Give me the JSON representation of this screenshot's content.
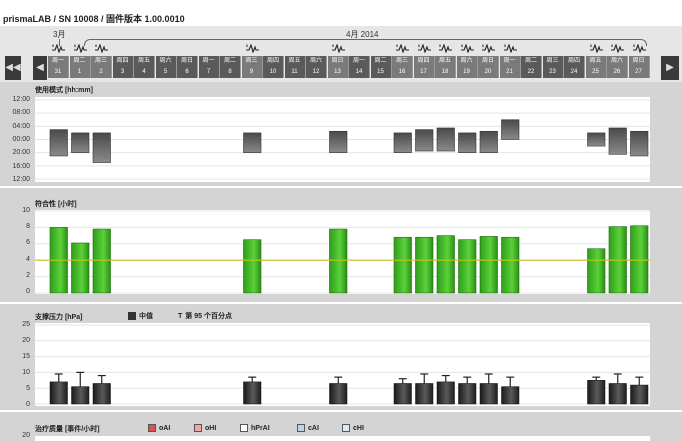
{
  "header": {
    "title": "prismaLAB / SN 10008 / 固件版本 1.00.0010"
  },
  "timeline": {
    "months": [
      {
        "label": "3月"
      },
      {
        "label": "4月 2014"
      }
    ],
    "prev_label": "◀◀",
    "next_label": "▶",
    "days": [
      {
        "wd": "周一",
        "d": "31",
        "data": true
      },
      {
        "wd": "周二",
        "d": "1",
        "data": true
      },
      {
        "wd": "周三",
        "d": "2",
        "data": true
      },
      {
        "wd": "周四",
        "d": "3",
        "data": false
      },
      {
        "wd": "周五",
        "d": "4",
        "data": false
      },
      {
        "wd": "周六",
        "d": "5",
        "data": false
      },
      {
        "wd": "周日",
        "d": "6",
        "data": false
      },
      {
        "wd": "周一",
        "d": "7",
        "data": false
      },
      {
        "wd": "周二",
        "d": "8",
        "data": false
      },
      {
        "wd": "周三",
        "d": "9",
        "data": true
      },
      {
        "wd": "周四",
        "d": "10",
        "data": false
      },
      {
        "wd": "周五",
        "d": "11",
        "data": false
      },
      {
        "wd": "周六",
        "d": "12",
        "data": false
      },
      {
        "wd": "周日",
        "d": "13",
        "data": true
      },
      {
        "wd": "周一",
        "d": "14",
        "data": false
      },
      {
        "wd": "周二",
        "d": "15",
        "data": false
      },
      {
        "wd": "周三",
        "d": "16",
        "data": true
      },
      {
        "wd": "周四",
        "d": "17",
        "data": true
      },
      {
        "wd": "周五",
        "d": "18",
        "data": true
      },
      {
        "wd": "周六",
        "d": "19",
        "data": true
      },
      {
        "wd": "周日",
        "d": "20",
        "data": true
      },
      {
        "wd": "周一",
        "d": "21",
        "data": true
      },
      {
        "wd": "周二",
        "d": "22",
        "data": false
      },
      {
        "wd": "周三",
        "d": "23",
        "data": false
      },
      {
        "wd": "周四",
        "d": "24",
        "data": false
      },
      {
        "wd": "周五",
        "d": "25",
        "data": true
      },
      {
        "wd": "周六",
        "d": "26",
        "data": true
      },
      {
        "wd": "周日",
        "d": "27",
        "data": true
      }
    ],
    "colors": {
      "day_bg": "#5a5a5a",
      "day_bg_data": "#7a7a7a",
      "nav_bg": "#3a3a3a"
    }
  },
  "panels": {
    "usage": {
      "title": "使用模式 [hh:mm]",
      "yticks": [
        "12:00",
        "08:00",
        "04:00",
        "00:00",
        "20:00",
        "16:00",
        "12:00"
      ]
    },
    "compliance": {
      "title": "符合性 [小时]",
      "yticks": [
        "10",
        "8",
        "6",
        "4",
        "2",
        "0"
      ]
    },
    "pressure": {
      "title": "支撑压力 [hPa]",
      "legend_median": "中值",
      "legend_p95_symbol": "T",
      "legend_p95": "第 95 个百分点",
      "yticks": [
        "25",
        "20",
        "15",
        "10",
        "5",
        "0"
      ]
    },
    "events": {
      "title": "治疗质量 [事件/小时]",
      "legend": [
        {
          "label": "oAI",
          "color": "#d9534f"
        },
        {
          "label": "oHI",
          "color": "#f4a6a0"
        },
        {
          "label": "hPrAI",
          "color": "#ffffff"
        },
        {
          "label": "cAI",
          "color": "#b8d4f0"
        },
        {
          "label": "cHI",
          "color": "#dce9f7"
        }
      ],
      "yticks": [
        "20"
      ]
    }
  },
  "chart_data": [
    {
      "type": "bar",
      "title": "使用模式 [hh:mm]",
      "categories": [
        "31",
        "1",
        "2",
        "3",
        "4",
        "5",
        "6",
        "7",
        "8",
        "9",
        "10",
        "11",
        "12",
        "13",
        "14",
        "15",
        "16",
        "17",
        "18",
        "19",
        "20",
        "21",
        "22",
        "23",
        "24",
        "25",
        "26",
        "27"
      ],
      "series": [
        {
          "name": "start_hours_after_noon",
          "values": [
            9.0,
            10.0,
            10.0,
            null,
            null,
            null,
            null,
            null,
            null,
            10.0,
            null,
            null,
            null,
            9.5,
            null,
            null,
            10.0,
            9.0,
            8.5,
            10.0,
            9.5,
            6.0,
            null,
            null,
            null,
            10.0,
            8.5,
            9.5
          ]
        },
        {
          "name": "end_hours_after_noon",
          "values": [
            17.0,
            16.0,
            19.0,
            null,
            null,
            null,
            null,
            null,
            null,
            16.0,
            null,
            null,
            null,
            16.0,
            null,
            null,
            16.0,
            15.5,
            15.5,
            16.0,
            16.0,
            12.0,
            null,
            null,
            null,
            14.0,
            16.5,
            17.0
          ]
        }
      ],
      "ylim": [
        0,
        24
      ]
    },
    {
      "type": "bar",
      "title": "符合性 [小时]",
      "categories": [
        "31",
        "1",
        "2",
        "3",
        "4",
        "5",
        "6",
        "7",
        "8",
        "9",
        "10",
        "11",
        "12",
        "13",
        "14",
        "15",
        "16",
        "17",
        "18",
        "19",
        "20",
        "21",
        "22",
        "23",
        "24",
        "25",
        "26",
        "27"
      ],
      "values": [
        8.0,
        6.1,
        7.8,
        null,
        null,
        null,
        null,
        null,
        null,
        6.5,
        null,
        null,
        null,
        7.8,
        null,
        null,
        6.8,
        6.8,
        7.0,
        6.5,
        6.9,
        6.8,
        null,
        null,
        null,
        5.4,
        8.1,
        8.2
      ],
      "threshold": 4,
      "ylim": [
        0,
        10
      ]
    },
    {
      "type": "bar",
      "title": "支撑压力 [hPa]",
      "categories": [
        "31",
        "1",
        "2",
        "3",
        "4",
        "5",
        "6",
        "7",
        "8",
        "9",
        "10",
        "11",
        "12",
        "13",
        "14",
        "15",
        "16",
        "17",
        "18",
        "19",
        "20",
        "21",
        "22",
        "23",
        "24",
        "25",
        "26",
        "27"
      ],
      "series": [
        {
          "name": "中值",
          "values": [
            7.0,
            5.5,
            6.5,
            null,
            null,
            null,
            null,
            null,
            null,
            7.0,
            null,
            null,
            null,
            6.5,
            null,
            null,
            6.5,
            6.5,
            7.0,
            6.5,
            6.5,
            5.5,
            null,
            null,
            null,
            7.5,
            6.5,
            6.0
          ]
        },
        {
          "name": "第 95 个百分点",
          "values": [
            9.5,
            10.0,
            9.0,
            null,
            null,
            null,
            null,
            null,
            null,
            8.5,
            null,
            null,
            null,
            8.5,
            null,
            null,
            8.0,
            9.5,
            9.0,
            8.5,
            9.5,
            8.5,
            null,
            null,
            null,
            8.5,
            9.5,
            8.5
          ]
        }
      ],
      "ylim": [
        0,
        25
      ]
    }
  ]
}
